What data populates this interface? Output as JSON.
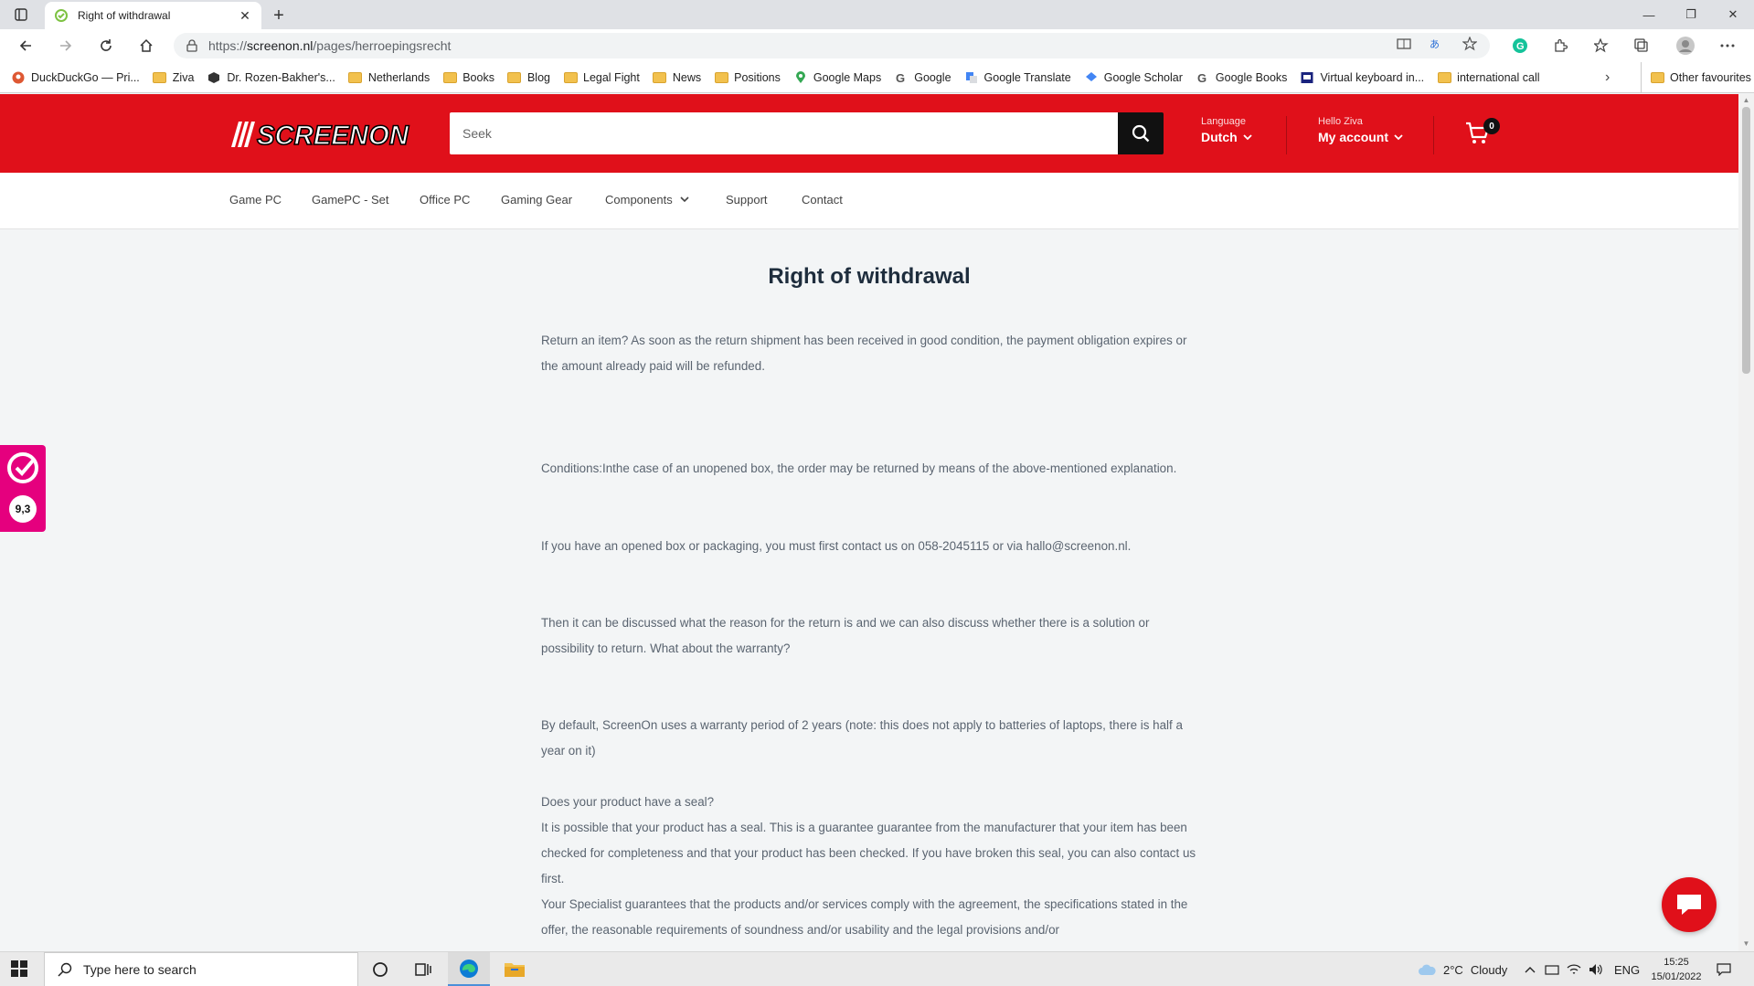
{
  "browser": {
    "tab_title": "Right of withdrawal",
    "url_scheme": "https://",
    "url_host": "screenon.nl",
    "url_path": "/pages/herroepingsrecht",
    "bookmarks": [
      {
        "label": "DuckDuckGo — Pri...",
        "icon": "duckduckgo-icon"
      },
      {
        "label": "Ziva",
        "icon": "folder-icon"
      },
      {
        "label": "Dr. Rozen-Bakher's...",
        "icon": "cube-icon"
      },
      {
        "label": "Netherlands",
        "icon": "folder-icon"
      },
      {
        "label": "Books",
        "icon": "folder-icon"
      },
      {
        "label": "Blog",
        "icon": "folder-icon"
      },
      {
        "label": "Legal Fight",
        "icon": "folder-icon"
      },
      {
        "label": "News",
        "icon": "folder-icon"
      },
      {
        "label": "Positions",
        "icon": "folder-icon"
      },
      {
        "label": "Google Maps",
        "icon": "maps-pin-icon"
      },
      {
        "label": "Google",
        "icon": "google-icon"
      },
      {
        "label": "Google Translate",
        "icon": "translate-icon"
      },
      {
        "label": "Google Scholar",
        "icon": "scholar-icon"
      },
      {
        "label": "Google Books",
        "icon": "google-icon"
      },
      {
        "label": "Virtual keyboard in...",
        "icon": "keyboard-icon"
      },
      {
        "label": "international call",
        "icon": "folder-icon"
      }
    ],
    "other_favourites": "Other favourites"
  },
  "header": {
    "search_placeholder": "Seek",
    "language_label": "Language",
    "language_value": "Dutch",
    "greeting": "Hello Ziva",
    "account_label": "My account",
    "cart_count": "0",
    "brand_color": "#e0101a"
  },
  "nav": {
    "items": [
      "Game PC",
      "GamePC - Set",
      "Office PC",
      "Gaming Gear",
      "Components",
      "Support",
      "Contact"
    ]
  },
  "page": {
    "title": "Right of withdrawal",
    "paragraphs": [
      "Return an item? As soon as the return shipment has been received in good condition, the payment obligation expires or the amount already paid will be refunded.",
      "Conditions:Inthe case of an unopened box, the order may be returned by means of the above-mentioned explanation.",
      "If you have an opened box or packaging, you must first contact us on 058-2045115 or via hallo@screenon.nl.",
      "Then it can be discussed what the reason for the return is and we can also discuss whether there is a solution or possibility to return. What about the warranty?",
      "By default, ScreenOn uses a warranty period of 2 years (note: this does not apply to batteries of laptops, there is half a year on it)",
      "Does your product have a seal?",
      "It is possible that your product has a seal. This is a guarantee guarantee from the manufacturer that your item has been checked for completeness and that your product has been checked. If you have broken this seal, you can also contact us first.",
      "Your Specialist guarantees that the products and/or services comply with the agreement, the specifications stated in the offer, the reasonable requirements of soundness and/or usability and the legal provisions and/or"
    ]
  },
  "widgets": {
    "review_score": "9,3",
    "review_color": "#e5007e"
  },
  "taskbar": {
    "search_placeholder": "Type here to search",
    "weather_temp": "2°C",
    "weather_desc": "Cloudy",
    "lang": "ENG",
    "time": "15:25",
    "date": "15/01/2022"
  }
}
